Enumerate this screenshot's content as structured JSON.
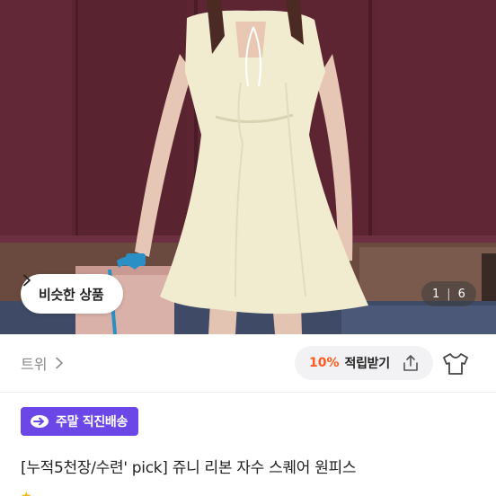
{
  "gallery": {
    "similar_button_label": "비슷한 상품",
    "counter_current": "1",
    "counter_separator": "|",
    "counter_total": "6"
  },
  "seller": {
    "name": "트위"
  },
  "reward": {
    "percent": "10%",
    "label": "적립받기"
  },
  "badge": {
    "label": "주말 직진배송"
  },
  "product": {
    "title": "[누적5천장/수련' pick] 쥬니 리본 자수 스퀘어 원피스"
  },
  "colors": {
    "badge_bg": "#6b47e8",
    "reward_percent": "#ff5a1f",
    "backdrop": "#5b2431"
  },
  "icons": {
    "similar_chevron": "chevron-right-icon",
    "seller_chevron": "chevron-right-icon",
    "share": "share-icon",
    "try_on": "tshirt-icon",
    "delivery": "delivery-arrow-icon"
  }
}
